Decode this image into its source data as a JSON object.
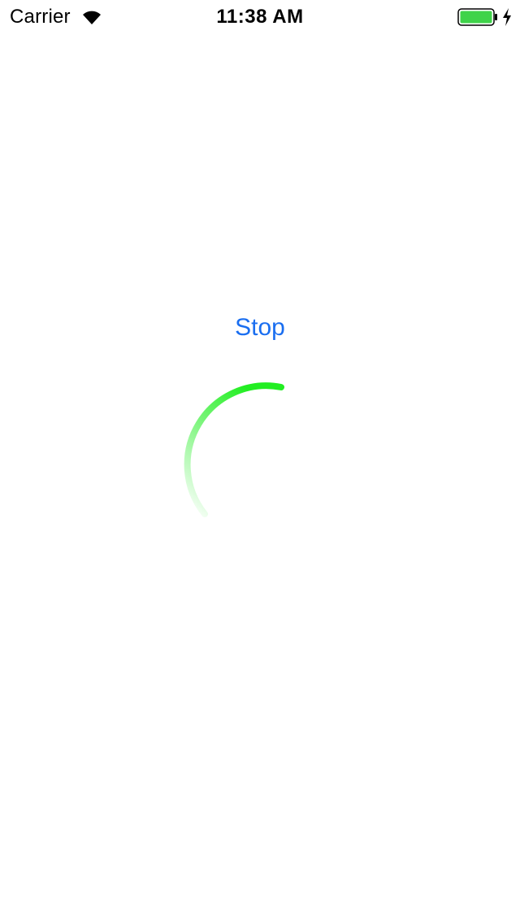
{
  "status_bar": {
    "carrier": "Carrier",
    "time": "11:38 AM",
    "wifi_icon": "wifi-icon",
    "battery_icon": "battery-icon",
    "charging_icon": "charging-bolt-icon",
    "battery_color": "#3fd34a"
  },
  "main": {
    "stop_label": "Stop",
    "stop_color": "#1a6ef0",
    "spinner": {
      "icon": "loading-spinner-icon",
      "color": "#22ee22"
    }
  }
}
